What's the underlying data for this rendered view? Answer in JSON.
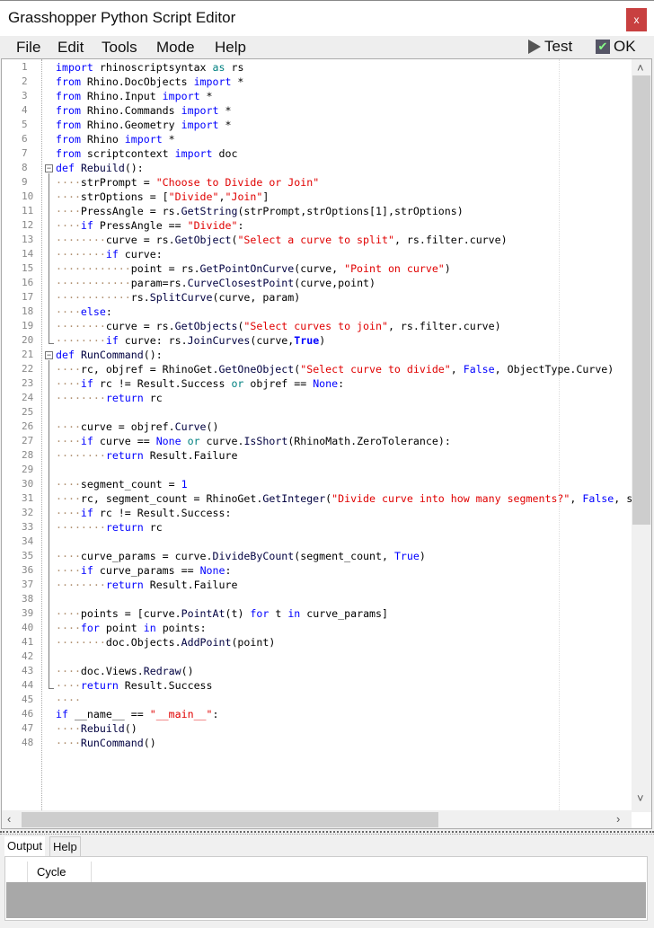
{
  "window": {
    "title": "Grasshopper Python Script Editor",
    "close": "x"
  },
  "menu": [
    "File",
    "Edit",
    "Tools",
    "Mode",
    "Help"
  ],
  "toolbar": {
    "test": "Test",
    "ok": "OK"
  },
  "code": [
    [
      [
        "k",
        "import"
      ],
      [
        "n",
        " rhinoscriptsyntax "
      ],
      [
        "t",
        "as"
      ],
      [
        "n",
        " rs"
      ]
    ],
    [
      [
        "k",
        "from"
      ],
      [
        "n",
        " Rhino.DocObjects "
      ],
      [
        "k",
        "import"
      ],
      [
        "n",
        " *"
      ]
    ],
    [
      [
        "k",
        "from"
      ],
      [
        "n",
        " Rhino.Input "
      ],
      [
        "k",
        "import"
      ],
      [
        "n",
        " *"
      ]
    ],
    [
      [
        "k",
        "from"
      ],
      [
        "n",
        " Rhino.Commands "
      ],
      [
        "k",
        "import"
      ],
      [
        "n",
        " *"
      ]
    ],
    [
      [
        "k",
        "from"
      ],
      [
        "n",
        " Rhino.Geometry "
      ],
      [
        "k",
        "import"
      ],
      [
        "n",
        " *"
      ]
    ],
    [
      [
        "k",
        "from"
      ],
      [
        "n",
        " Rhino "
      ],
      [
        "k",
        "import"
      ],
      [
        "n",
        " *"
      ]
    ],
    [
      [
        "k",
        "from"
      ],
      [
        "n",
        " scriptcontext "
      ],
      [
        "k",
        "import"
      ],
      [
        "n",
        " doc"
      ]
    ],
    [
      [
        "k",
        "def"
      ],
      [
        "n",
        " "
      ],
      [
        "m",
        "Rebuild"
      ],
      [
        "n",
        "():"
      ]
    ],
    [
      [
        "d",
        "····"
      ],
      [
        "n",
        "strPrompt = "
      ],
      [
        "s",
        "\"Choose to Divide or Join\""
      ]
    ],
    [
      [
        "d",
        "····"
      ],
      [
        "n",
        "strOptions = ["
      ],
      [
        "s",
        "\"Divide\""
      ],
      [
        "n",
        ","
      ],
      [
        "s",
        "\"Join\""
      ],
      [
        "n",
        "]"
      ]
    ],
    [
      [
        "d",
        "····"
      ],
      [
        "n",
        "PressAngle = rs."
      ],
      [
        "m",
        "GetString"
      ],
      [
        "n",
        "(strPrompt,strOptions[1],strOptions)"
      ]
    ],
    [
      [
        "d",
        "····"
      ],
      [
        "k",
        "if"
      ],
      [
        "n",
        " PressAngle == "
      ],
      [
        "s",
        "\"Divide\""
      ],
      [
        "n",
        ":"
      ]
    ],
    [
      [
        "d",
        "········"
      ],
      [
        "n",
        "curve = rs."
      ],
      [
        "m",
        "GetObject"
      ],
      [
        "n",
        "("
      ],
      [
        "s",
        "\"Select a curve to split\""
      ],
      [
        "n",
        ", rs.filter.curve)"
      ]
    ],
    [
      [
        "d",
        "········"
      ],
      [
        "k",
        "if"
      ],
      [
        "n",
        " curve:"
      ]
    ],
    [
      [
        "d",
        "············"
      ],
      [
        "n",
        "point = rs."
      ],
      [
        "m",
        "GetPointOnCurve"
      ],
      [
        "n",
        "(curve, "
      ],
      [
        "s",
        "\"Point on curve\""
      ],
      [
        "n",
        ")"
      ]
    ],
    [
      [
        "d",
        "············"
      ],
      [
        "n",
        "param=rs."
      ],
      [
        "m",
        "CurveClosestPoint"
      ],
      [
        "n",
        "(curve,point)"
      ]
    ],
    [
      [
        "d",
        "············"
      ],
      [
        "n",
        "rs."
      ],
      [
        "m",
        "SplitCurve"
      ],
      [
        "n",
        "(curve, param)"
      ]
    ],
    [
      [
        "d",
        "····"
      ],
      [
        "k",
        "else"
      ],
      [
        "n",
        ":"
      ]
    ],
    [
      [
        "d",
        "········"
      ],
      [
        "n",
        "curve = rs."
      ],
      [
        "m",
        "GetObjects"
      ],
      [
        "n",
        "("
      ],
      [
        "s",
        "\"Select curves to join\""
      ],
      [
        "n",
        ", rs.filter.curve)"
      ]
    ],
    [
      [
        "d",
        "········"
      ],
      [
        "k",
        "if"
      ],
      [
        "n",
        " curve: rs."
      ],
      [
        "m",
        "JoinCurves"
      ],
      [
        "n",
        "(curve,"
      ],
      [
        "b",
        "True"
      ],
      [
        "n",
        ")"
      ]
    ],
    [
      [
        "k",
        "def"
      ],
      [
        "n",
        " "
      ],
      [
        "m",
        "RunCommand"
      ],
      [
        "n",
        "():"
      ]
    ],
    [
      [
        "d",
        "····"
      ],
      [
        "n",
        "rc, objref = RhinoGet."
      ],
      [
        "m",
        "GetOneObject"
      ],
      [
        "n",
        "("
      ],
      [
        "s",
        "\"Select curve to divide\""
      ],
      [
        "n",
        ", "
      ],
      [
        "k",
        "False"
      ],
      [
        "n",
        ", ObjectType.Curve)"
      ]
    ],
    [
      [
        "d",
        "····"
      ],
      [
        "k",
        "if"
      ],
      [
        "n",
        " rc != Result.Success "
      ],
      [
        "t",
        "or"
      ],
      [
        "n",
        " objref == "
      ],
      [
        "k",
        "None"
      ],
      [
        "n",
        ":"
      ]
    ],
    [
      [
        "d",
        "········"
      ],
      [
        "k",
        "return"
      ],
      [
        "n",
        " rc"
      ]
    ],
    [],
    [
      [
        "d",
        "····"
      ],
      [
        "n",
        "curve = objref."
      ],
      [
        "m",
        "Curve"
      ],
      [
        "n",
        "()"
      ]
    ],
    [
      [
        "d",
        "····"
      ],
      [
        "k",
        "if"
      ],
      [
        "n",
        " curve == "
      ],
      [
        "k",
        "None"
      ],
      [
        "n",
        " "
      ],
      [
        "t",
        "or"
      ],
      [
        "n",
        " curve."
      ],
      [
        "m",
        "IsShort"
      ],
      [
        "n",
        "(RhinoMath.ZeroTolerance):"
      ]
    ],
    [
      [
        "d",
        "········"
      ],
      [
        "k",
        "return"
      ],
      [
        "n",
        " Result.Failure"
      ]
    ],
    [],
    [
      [
        "d",
        "····"
      ],
      [
        "n",
        "segment_count = "
      ],
      [
        "k",
        "1"
      ]
    ],
    [
      [
        "d",
        "····"
      ],
      [
        "n",
        "rc, segment_count = RhinoGet."
      ],
      [
        "m",
        "GetInteger"
      ],
      [
        "n",
        "("
      ],
      [
        "s",
        "\"Divide curve into how many segments?\""
      ],
      [
        "n",
        ", "
      ],
      [
        "k",
        "False"
      ],
      [
        "n",
        ", s"
      ]
    ],
    [
      [
        "d",
        "····"
      ],
      [
        "k",
        "if"
      ],
      [
        "n",
        " rc != Result.Success:"
      ]
    ],
    [
      [
        "d",
        "········"
      ],
      [
        "k",
        "return"
      ],
      [
        "n",
        " rc"
      ]
    ],
    [],
    [
      [
        "d",
        "····"
      ],
      [
        "n",
        "curve_params = curve."
      ],
      [
        "m",
        "DivideByCount"
      ],
      [
        "n",
        "(segment_count, "
      ],
      [
        "k",
        "True"
      ],
      [
        "n",
        ")"
      ]
    ],
    [
      [
        "d",
        "····"
      ],
      [
        "k",
        "if"
      ],
      [
        "n",
        " curve_params == "
      ],
      [
        "k",
        "None"
      ],
      [
        "n",
        ":"
      ]
    ],
    [
      [
        "d",
        "········"
      ],
      [
        "k",
        "return"
      ],
      [
        "n",
        " Result.Failure"
      ]
    ],
    [],
    [
      [
        "d",
        "····"
      ],
      [
        "n",
        "points = [curve."
      ],
      [
        "m",
        "PointAt"
      ],
      [
        "n",
        "(t) "
      ],
      [
        "k",
        "for"
      ],
      [
        "n",
        " t "
      ],
      [
        "k",
        "in"
      ],
      [
        "n",
        " curve_params]"
      ]
    ],
    [
      [
        "d",
        "····"
      ],
      [
        "k",
        "for"
      ],
      [
        "n",
        " point "
      ],
      [
        "k",
        "in"
      ],
      [
        "n",
        " points:"
      ]
    ],
    [
      [
        "d",
        "········"
      ],
      [
        "n",
        "doc.Objects."
      ],
      [
        "m",
        "AddPoint"
      ],
      [
        "n",
        "(point)"
      ]
    ],
    [],
    [
      [
        "d",
        "····"
      ],
      [
        "n",
        "doc.Views."
      ],
      [
        "m",
        "Redraw"
      ],
      [
        "n",
        "()"
      ]
    ],
    [
      [
        "d",
        "····"
      ],
      [
        "k",
        "return"
      ],
      [
        "n",
        " Result.Success"
      ]
    ],
    [
      [
        "d",
        "····"
      ]
    ],
    [
      [
        "k",
        "if"
      ],
      [
        "n",
        " __name__ == "
      ],
      [
        "s",
        "\"__main__\""
      ],
      [
        "n",
        ":"
      ]
    ],
    [
      [
        "d",
        "····"
      ],
      [
        "m",
        "Rebuild"
      ],
      [
        "n",
        "()"
      ]
    ],
    [
      [
        "d",
        "····"
      ],
      [
        "m",
        "RunCommand"
      ],
      [
        "n",
        "()"
      ]
    ]
  ],
  "output_panel": {
    "tabs": [
      "Output",
      "Help"
    ],
    "active_tab": "Output",
    "columns": [
      "",
      "Cycle"
    ]
  },
  "colors": {
    "close": "#c84040",
    "keyword": "#0000ff",
    "string": "#e00000",
    "operator_word": "#008080"
  }
}
